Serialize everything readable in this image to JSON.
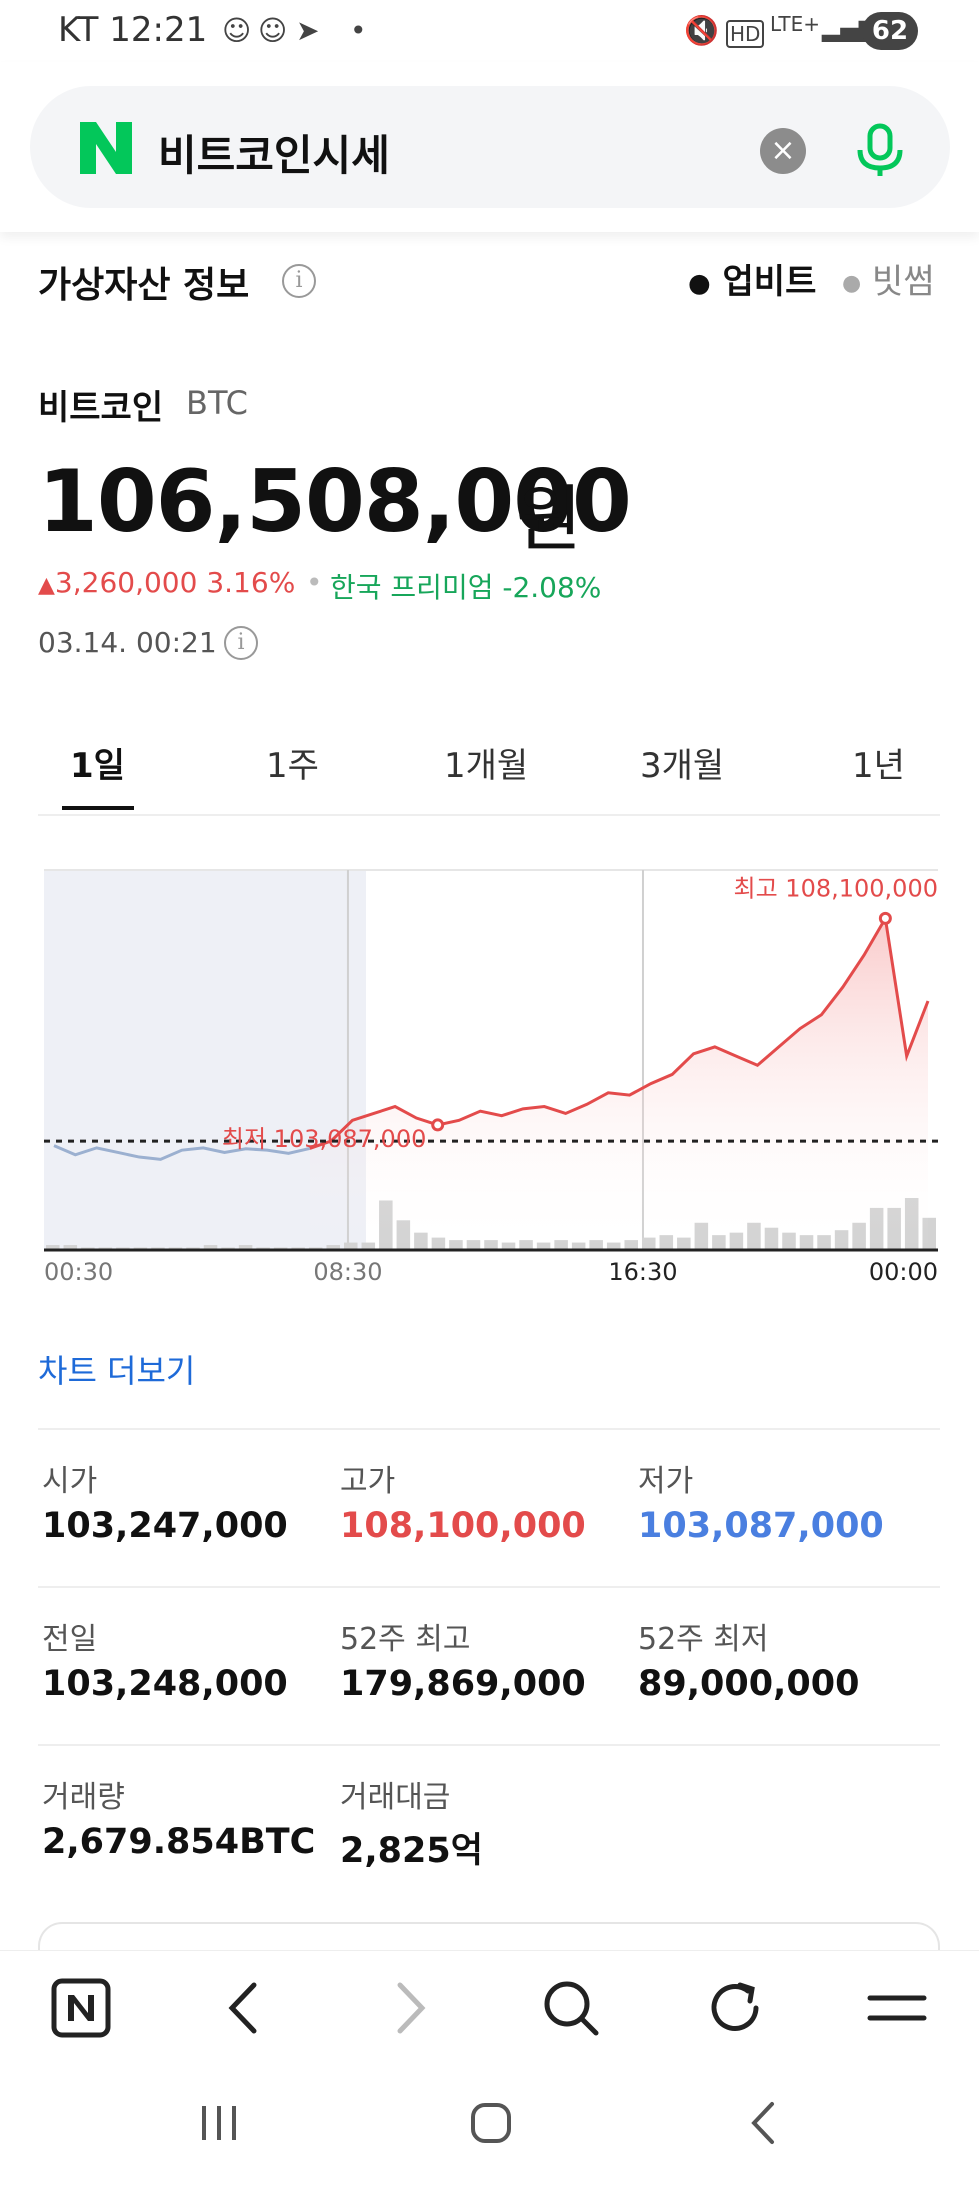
{
  "status_bar": {
    "carrier": "KT",
    "time": "12:21",
    "battery": "62",
    "network": "LTE+"
  },
  "search": {
    "query": "비트코인시세",
    "clear_label": "×"
  },
  "section": {
    "title": "가상자산 정보",
    "info_icon": "i",
    "exchanges": [
      "업비트",
      "빗썸"
    ],
    "selected_exchange": "업비트"
  },
  "coin": {
    "name": "비트코인",
    "symbol": "BTC",
    "price": "106,508,000",
    "currency": "원",
    "change_arrow": "▲",
    "change_amount": "3,260,000",
    "change_percent": "3.16%",
    "separator": "•",
    "premium": "한국 프리미엄 -2.08%",
    "timestamp": "03.14. 00:21"
  },
  "tabs": [
    "1일",
    "1주",
    "1개월",
    "3개월",
    "1년"
  ],
  "active_tab": "1일",
  "chart_data": {
    "type": "line",
    "x_ticks": [
      "00:30",
      "08:30",
      "16:30",
      "00:00"
    ],
    "high_label": "최고 108,100,000",
    "low_label": "최저 103,087,000",
    "high": 108100000,
    "low": 103087000,
    "open": 103247000,
    "series": [
      {
        "color_before": "#9bb0d0",
        "color_after": "#e34b4b",
        "values": [
          103150000,
          102950000,
          103100000,
          103000000,
          102900000,
          102850000,
          103050000,
          103100000,
          103000000,
          103080000,
          103050000,
          102980000,
          103087000,
          103250000,
          103700000,
          103850000,
          104000000,
          103750000,
          103600000,
          103700000,
          103900000,
          103800000,
          103950000,
          104000000,
          103850000,
          104050000,
          104300000,
          104250000,
          104500000,
          104700000,
          105150000,
          105300000,
          105100000,
          104900000,
          105300000,
          105700000,
          106000000,
          106600000,
          107300000,
          108100000,
          105100000,
          106300000
        ]
      }
    ],
    "volume": [
      2,
      2,
      1,
      1,
      1,
      1,
      1,
      1,
      1,
      2,
      1,
      2,
      1,
      1,
      1,
      1,
      2,
      3,
      3,
      20,
      12,
      7,
      5,
      4,
      4,
      4,
      3,
      4,
      3,
      4,
      3,
      4,
      3,
      4,
      5,
      6,
      5,
      11,
      6,
      7,
      11,
      9,
      7,
      6,
      6,
      8,
      11,
      17,
      17,
      21,
      13
    ],
    "shaded_until_tick": "08:30"
  },
  "chart_more_label": "차트 더보기",
  "stats": [
    {
      "label": "시가",
      "value": "103,247,000",
      "tone": "normal"
    },
    {
      "label": "고가",
      "value": "108,100,000",
      "tone": "red"
    },
    {
      "label": "저가",
      "value": "103,087,000",
      "tone": "blue"
    },
    {
      "label": "전일",
      "value": "103,248,000",
      "tone": "normal"
    },
    {
      "label": "52주 최고",
      "value": "179,869,000",
      "tone": "normal"
    },
    {
      "label": "52주 최저",
      "value": "89,000,000",
      "tone": "normal"
    },
    {
      "label": "거래량",
      "value": "2,679.854BTC",
      "tone": "normal"
    },
    {
      "label": "거래대금",
      "value": "2,825억",
      "tone": "normal"
    }
  ],
  "colors": {
    "up": "#e34b4b",
    "down": "#4a7fe0",
    "premium": "#17a65a",
    "brand": "#03c75a",
    "link": "#1e6ad8"
  }
}
